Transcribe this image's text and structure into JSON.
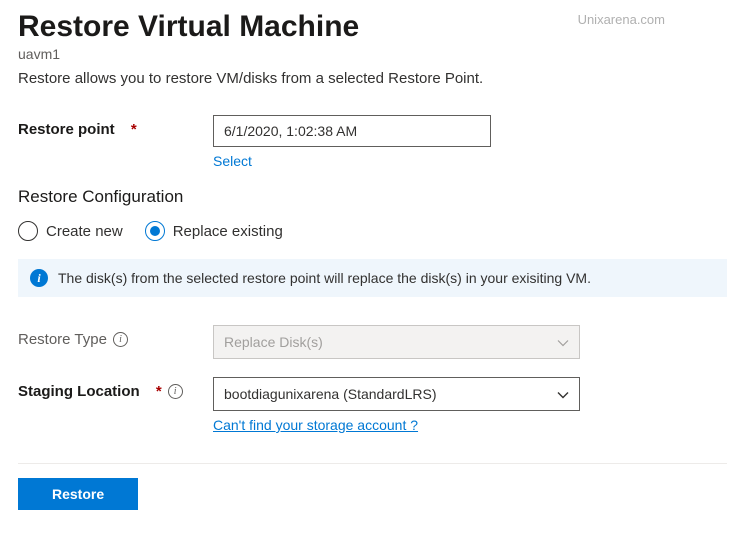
{
  "header": {
    "title": "Restore Virtual Machine",
    "subtitle": "uavm1",
    "watermark": "Unixarena.com"
  },
  "description": "Restore allows you to restore VM/disks from a selected Restore Point.",
  "restore_point": {
    "label": "Restore point",
    "value": "6/1/2020, 1:02:38 AM",
    "select_link": "Select"
  },
  "config": {
    "header": "Restore Configuration",
    "option_create": "Create new",
    "option_replace": "Replace existing"
  },
  "info_banner": "The disk(s) from the selected restore point will replace the disk(s) in your exisiting VM.",
  "restore_type": {
    "label": "Restore Type",
    "value": "Replace Disk(s)"
  },
  "staging": {
    "label": "Staging Location",
    "value": "bootdiagunixarena (StandardLRS)",
    "help_link": "Can't find your storage account ?"
  },
  "actions": {
    "restore": "Restore"
  }
}
